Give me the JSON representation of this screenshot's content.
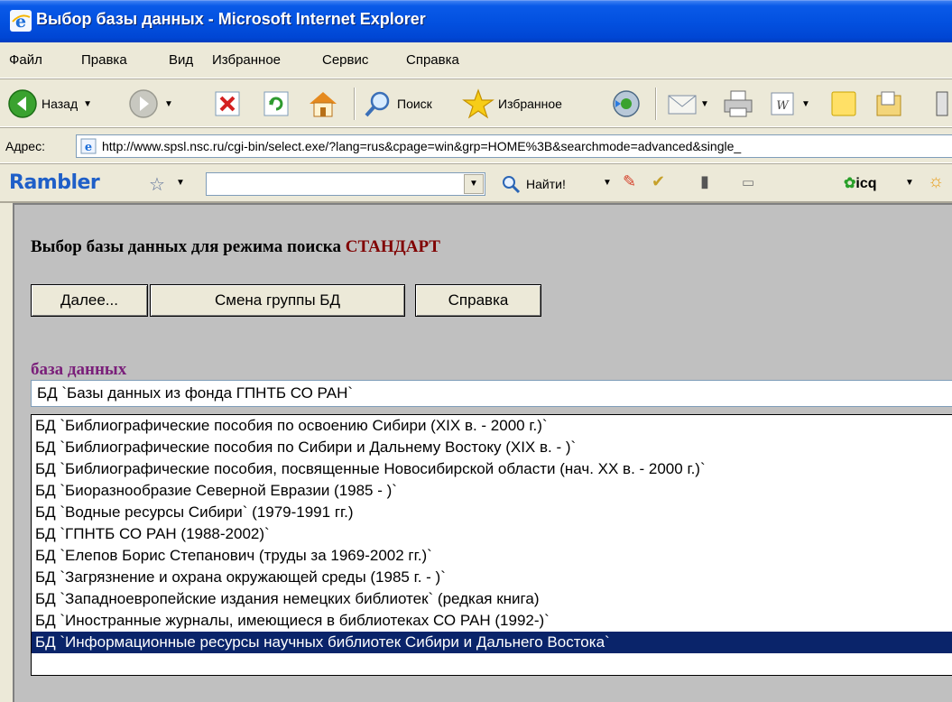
{
  "window": {
    "title": "Выбор базы данных - Microsoft Internet Explorer"
  },
  "menu": [
    "Файл",
    "Правка",
    "Вид",
    "Избранное",
    "Сервис",
    "Справка"
  ],
  "toolbar": {
    "back_label": "Назад",
    "search_label": "Поиск",
    "favorites_label": "Избранное"
  },
  "address": {
    "label": "Адрес:",
    "url": "http://www.spsl.nsc.ru/cgi-bin/select.exe/?lang=rus&cpage=win&grp=HOME%3B&searchmode=advanced&single_"
  },
  "rambler": {
    "logo": "Rambler",
    "search_value": "",
    "find_label": "Найти!",
    "icq_label": "icq"
  },
  "page": {
    "heading": "Выбор базы данных для режима поиска",
    "mode": "СТАНДАРТ",
    "buttons": {
      "next": "Далее...",
      "change_group": "Смена группы БД",
      "help": "Справка"
    },
    "db_label": "база данных",
    "selected_value": "БД `Базы данных из фонда ГПНТБ СО РАН`",
    "options": [
      "БД `Библиографические пособия по освоению Сибири (XIX в. - 2000 г.)`",
      "БД `Библиографические пособия по Сибири и Дальнему Востоку (XIX в. - )`",
      "БД `Библиографические пособия, посвященные Новосибирской области (нач. XX в. - 2000 г.)`",
      "БД `Биоразнообразие Северной Евразии (1985 - )`",
      "БД `Водные ресурсы Сибири` (1979-1991 гг.)",
      "БД `ГПНТБ СО РАН (1988-2002)`",
      "БД `Елепов Борис Степанович (труды за 1969-2002 гг.)`",
      "БД `Загрязнение и охрана окружающей среды (1985 г. - )`",
      "БД `Западноевропейские издания немецких библиотек` (редкая книга)",
      "БД `Иностранные журналы, имеющиеся в библиотеках СО РАН (1992-)`",
      "БД `Информационные ресурсы научных библиотек Сибири и Дальнего Востока`"
    ],
    "selected_option_index": 10
  }
}
